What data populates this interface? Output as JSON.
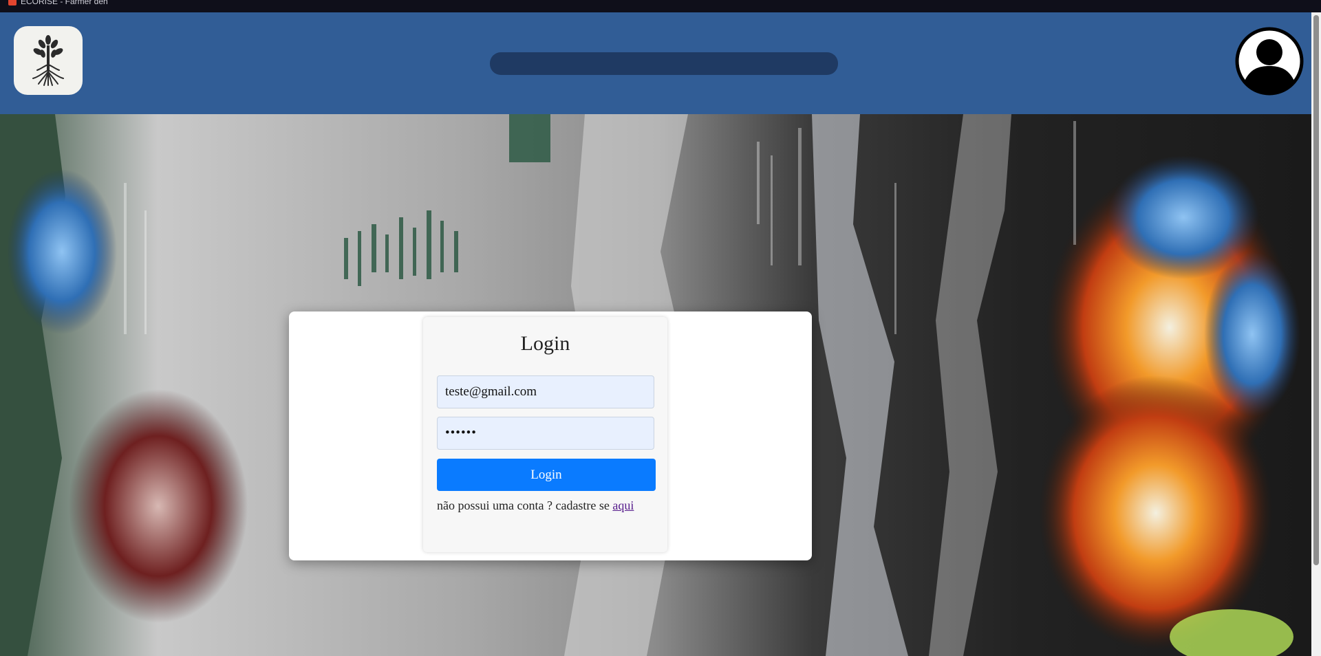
{
  "browser": {
    "tab_title": "ECORISE - Farmer deh"
  },
  "header": {
    "logo_icon": "tree-logo-icon",
    "search": {
      "value": "",
      "placeholder": ""
    },
    "avatar_icon": "user-avatar-icon"
  },
  "login": {
    "title": "Login",
    "email_value": "teste@gmail.com",
    "password_value": "••••••",
    "button_label": "Login",
    "signup_text": "não possui uma conta ? cadastre se",
    "signup_link": "aqui"
  },
  "colors": {
    "header_bg": "#315d96",
    "search_bg": "#1f3a63",
    "button_bg": "#0a7bff",
    "input_bg": "#e8f0fe"
  }
}
